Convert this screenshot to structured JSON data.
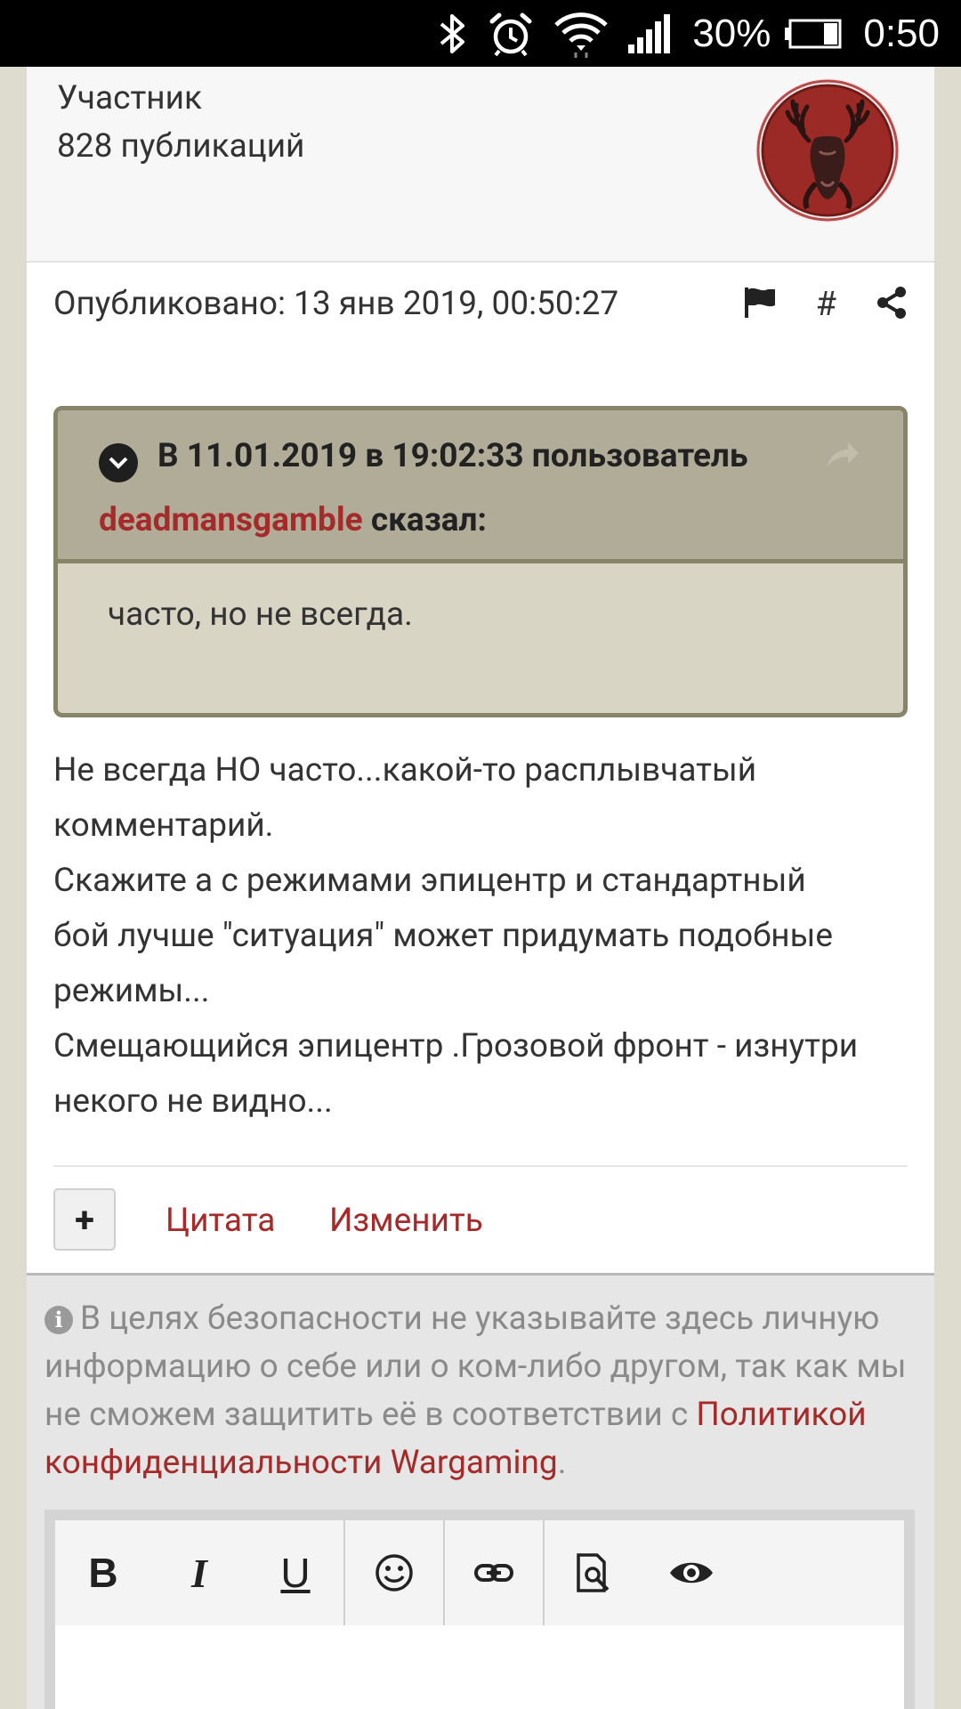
{
  "status_bar": {
    "battery_percent": "30%",
    "time": "0:50",
    "icons": [
      "bluetooth-icon",
      "alarm-icon",
      "wifi-icon",
      "signal-icon",
      "battery-icon"
    ]
  },
  "author": {
    "rank": "Участник",
    "posts": "828 публикаций"
  },
  "post": {
    "published": "Опубликовано: 13 янв 2019, 00:50:27",
    "hash": "#",
    "quote": {
      "header_prefix": "В 11.01.2019 в 19:02:33 пользователь",
      "user": "deadmansgamble",
      "said": " сказал:",
      "body": "часто, но не всегда."
    },
    "lines": [
      "Не всегда НО часто...какой-то расплывчатый",
      "комментарий.",
      "Скажите а с режимами эпицентр и стандартный",
      "бой лучше \"ситуация\" может придумать подобные",
      "режимы...",
      "Смещающийся эпицентр .Грозовой фронт - изнутри",
      "некого не видно..."
    ],
    "actions": {
      "plus": "+",
      "quote": "Цитата",
      "edit": "Изменить"
    }
  },
  "reply": {
    "notice_text": "В целях безопасности не указывайте здесь личную информацию о себе или о ком-либо другом, так как мы не сможем защитить её в соответствии с ",
    "policy_link": "Политикой конфиденциальности Wargaming",
    "period": ".",
    "toolbar": {
      "bold": "B",
      "italic": "I",
      "underline": "U"
    }
  },
  "colors": {
    "accent": "#a52a2a",
    "quote_head": "#b1ac97",
    "quote_body": "#d8d5c4",
    "background": "#dedccf"
  }
}
